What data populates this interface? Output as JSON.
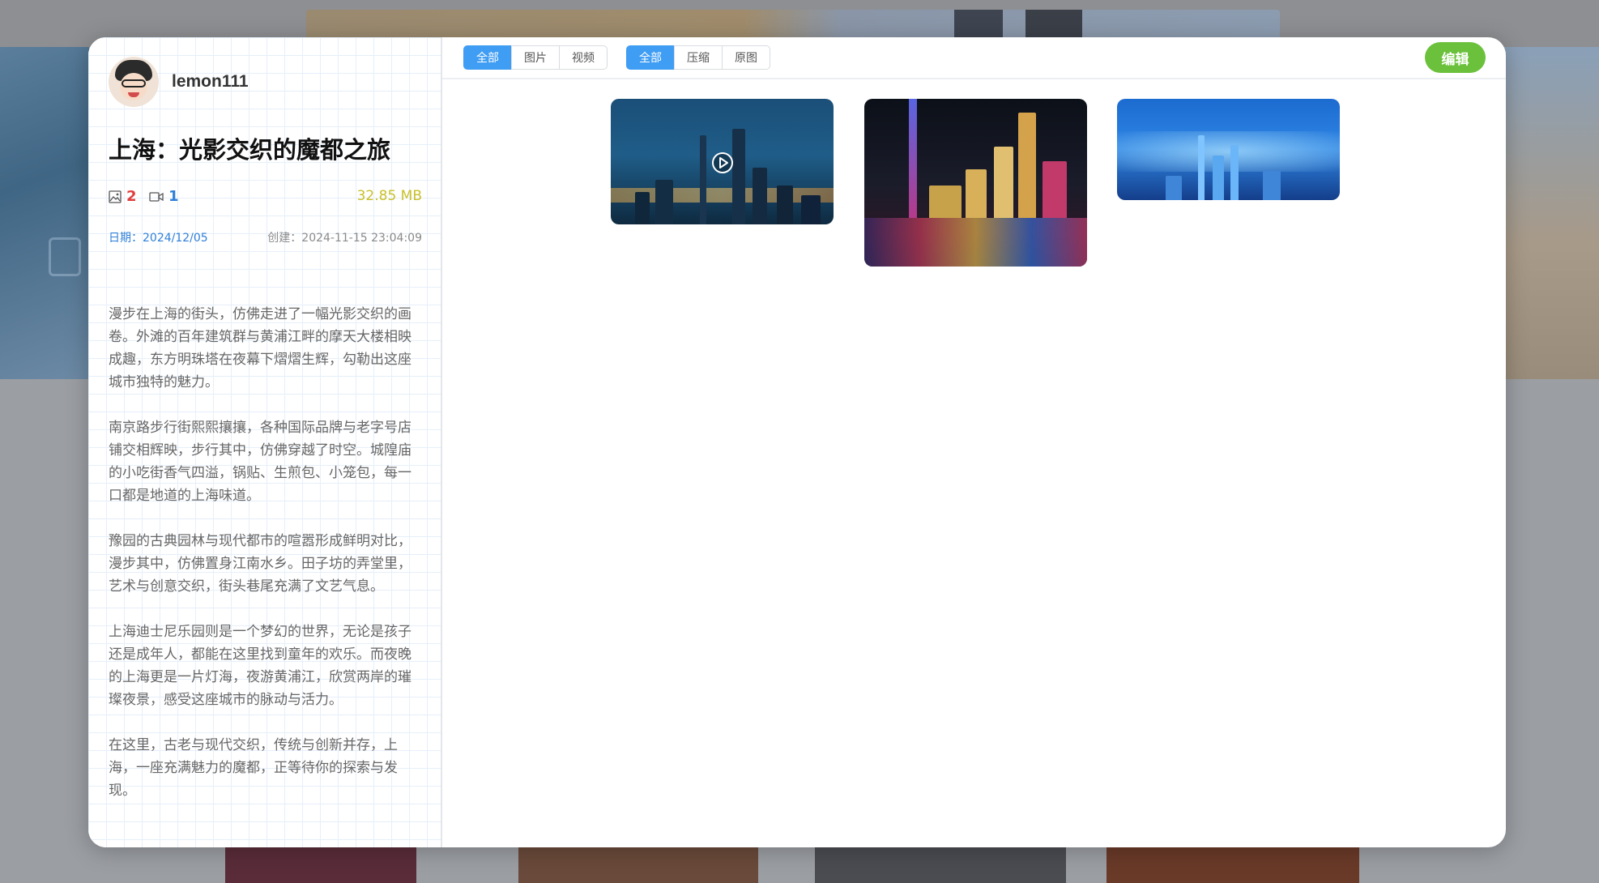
{
  "author": {
    "name": "lemon111"
  },
  "post": {
    "title": "上海：光影交织的魔都之旅",
    "image_count": "2",
    "video_count": "1",
    "size": "32.85 MB",
    "date": "日期：2024/12/05",
    "created": "创建：2024-11-15 23:04:09",
    "paragraphs": [
      "漫步在上海的街头，仿佛走进了一幅光影交织的画卷。外滩的百年建筑群与黄浦江畔的摩天大楼相映成趣，东方明珠塔在夜幕下熠熠生辉，勾勒出这座城市独特的魅力。",
      "南京路步行街熙熙攘攘，各种国际品牌与老字号店铺交相辉映，步行其中，仿佛穿越了时空。城隍庙的小吃街香气四溢，锅贴、生煎包、小笼包，每一口都是地道的上海味道。",
      "豫园的古典园林与现代都市的喧嚣形成鲜明对比，漫步其中，仿佛置身江南水乡。田子坊的弄堂里，艺术与创意交织，街头巷尾充满了文艺气息。",
      "上海迪士尼乐园则是一个梦幻的世界，无论是孩子还是成年人，都能在这里找到童年的欢乐。而夜晚的上海更是一片灯海，夜游黄浦江，欣赏两岸的璀璨夜景，感受这座城市的脉动与活力。",
      "在这里，古老与现代交织，传统与创新并存，上海，一座充满魅力的魔都，正等待你的探索与发现。"
    ]
  },
  "filters": {
    "type": {
      "options": [
        "全部",
        "图片",
        "视频"
      ],
      "selected": "全部"
    },
    "quality": {
      "options": [
        "全部",
        "压缩",
        "原图"
      ],
      "selected": "全部"
    }
  },
  "toolbar": {
    "edit_label": "编辑"
  },
  "gallery": [
    {
      "kind": "video",
      "icon": "play-icon"
    },
    {
      "kind": "image"
    },
    {
      "kind": "image"
    }
  ],
  "colors": {
    "accent": "#3f9df4",
    "edit": "#6cc13c",
    "image_count": "#e23c3c",
    "video_count": "#2f7fd8",
    "size": "#c8c02a"
  }
}
